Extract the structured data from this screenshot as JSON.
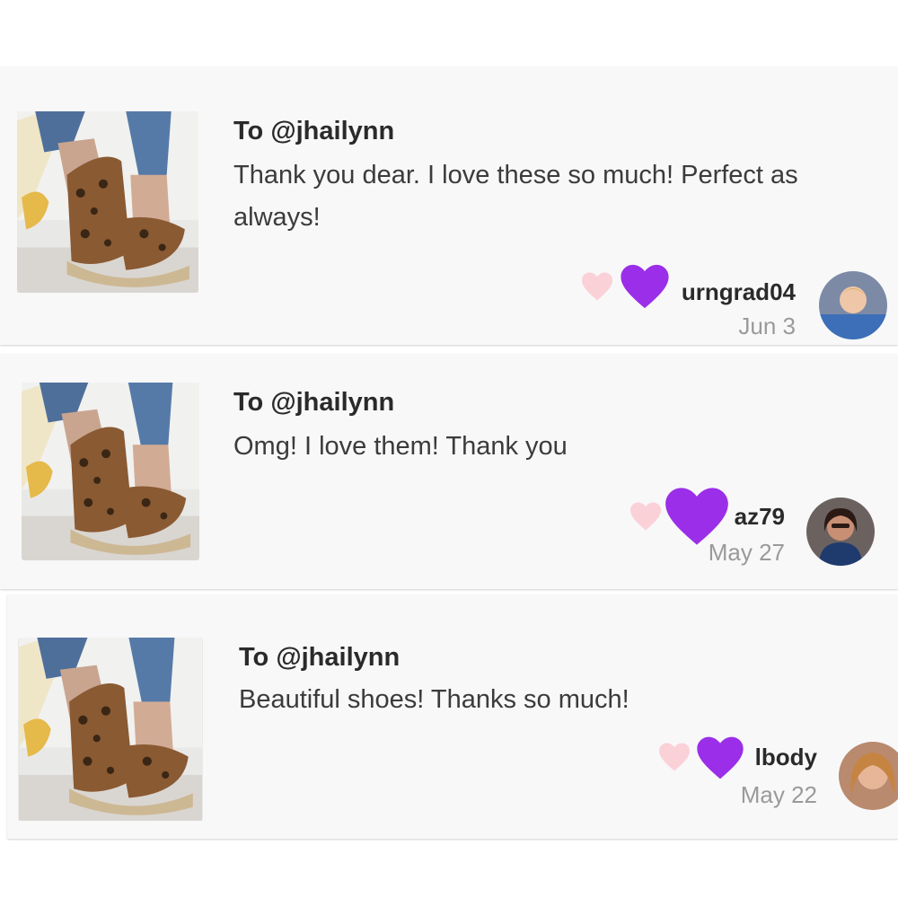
{
  "reviews": [
    {
      "to": "To @jhailynn",
      "message": "Thank you dear. I love these so much! Perfect as always!",
      "username": "urngrad04",
      "date": "Jun 3",
      "heart_icon": "heart-icon",
      "emoji": "purple-heart"
    },
    {
      "to": "To @jhailynn",
      "message": "Omg! I love them! Thank you",
      "username": "az79",
      "date": "May 27",
      "heart_icon": "heart-icon",
      "emoji": "purple-heart"
    },
    {
      "to": "To @jhailynn",
      "message": "Beautiful shoes! Thanks so much!",
      "username": "lbody",
      "date": "May 22",
      "heart_icon": "heart-icon",
      "emoji": "purple-heart"
    }
  ],
  "colors": {
    "like_heart": "#fbd1d8",
    "emoji_heart": "#9b2ee8",
    "card_bg": "#f8f8f9",
    "date_text": "#9a9a9a"
  }
}
